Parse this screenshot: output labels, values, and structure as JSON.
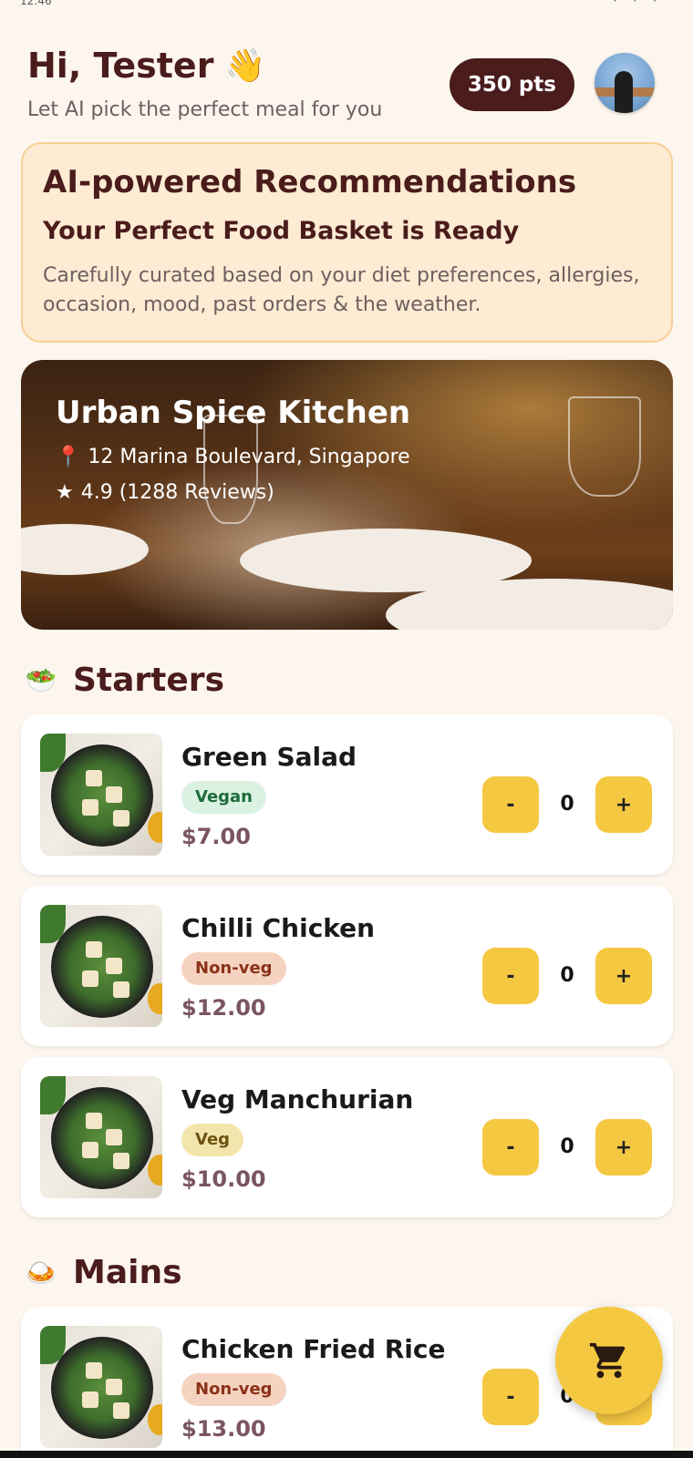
{
  "status_bar": {
    "time": "12:46"
  },
  "header": {
    "greeting": "Hi, Tester",
    "wave_emoji": "👋",
    "subtitle": "Let AI pick the perfect meal for you",
    "points": "350 pts"
  },
  "ai_card": {
    "title": "AI-powered Recommendations",
    "subtitle": "Your Perfect Food Basket is Ready",
    "description": "Carefully curated based on your diet preferences, allergies, occasion, mood, past orders & the weather."
  },
  "restaurant": {
    "name": "Urban Spice Kitchen",
    "pin": "📍",
    "address": "12 Marina Boulevard, Singapore",
    "star": "★",
    "rating": "4.9 (1288 Reviews)"
  },
  "sections": [
    {
      "title": "Starters",
      "icon": "🥗",
      "icon_name": "salad-icon"
    },
    {
      "title": "Mains",
      "icon": "🍛",
      "icon_name": "curry-rice-icon"
    }
  ],
  "items": [
    {
      "name": "Green Salad",
      "tag": "Vegan",
      "price": "$7.00",
      "qty": "0"
    },
    {
      "name": "Chilli Chicken",
      "tag": "Non-veg",
      "price": "$12.00",
      "qty": "0"
    },
    {
      "name": "Veg Manchurian",
      "tag": "Veg",
      "price": "$10.00",
      "qty": "0"
    },
    {
      "name": "Chicken Fried Rice",
      "tag": "Non-veg",
      "price": "$13.00",
      "qty": "0"
    }
  ],
  "controls": {
    "minus": "-",
    "plus": "+"
  },
  "colors": {
    "background": "#fdf6ef",
    "brand_dark": "#4a1c1c",
    "accent_yellow": "#f5c842",
    "card_peach": "#fdebd3"
  }
}
